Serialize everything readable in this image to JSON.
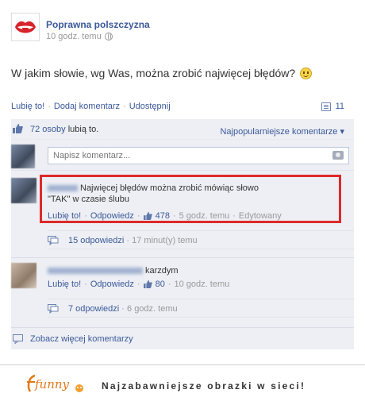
{
  "post": {
    "page_name": "Poprawna polszczyzna",
    "time": "10 godz. temu",
    "text": "W jakim słowie, wg Was, można zrobić najwięcej błędów?",
    "actions": {
      "like": "Lubię to!",
      "comment": "Dodaj komentarz",
      "share": "Udostępnij"
    },
    "comments_count": "11"
  },
  "ufi": {
    "likes_count": "72 osoby",
    "likes_suffix": "lubią to.",
    "sort_label": "Najpopularniejsze komentarze ▾",
    "compose_placeholder": "Napisz komentarz...",
    "comments": [
      {
        "text_line1": "Najwięcej błędów można zrobić mówiąc słowo",
        "text_line2": "\"TAK\" w czasie ślubu",
        "like": "Lubię to!",
        "reply": "Odpowiedz",
        "likes": "478",
        "time": "5 godz. temu",
        "edited": "Edytowany",
        "replies": "15 odpowiedzi",
        "replies_time": "17 minut(y) temu"
      },
      {
        "text": "karzdym",
        "like": "Lubię to!",
        "reply": "Odpowiedz",
        "likes": "80",
        "time": "10 godz. temu",
        "replies": "7 odpowiedzi",
        "replies_time": "6 godz. temu"
      }
    ],
    "more_comments": "Zobacz więcej komentarzy"
  },
  "footer": {
    "logo_text": "funny",
    "tagline": "Najzabawniejsze obrazki w sieci!"
  },
  "colors": {
    "link": "#3b5998",
    "highlight": "#dc2a2a",
    "ufi_bg": "#edeff4"
  },
  "icons": [
    "lips-logo-icon",
    "globe-icon",
    "smiley-icon",
    "comment-count-icon",
    "thumbs-up-icon",
    "camera-icon",
    "reply-icon",
    "funny-logo-icon"
  ]
}
